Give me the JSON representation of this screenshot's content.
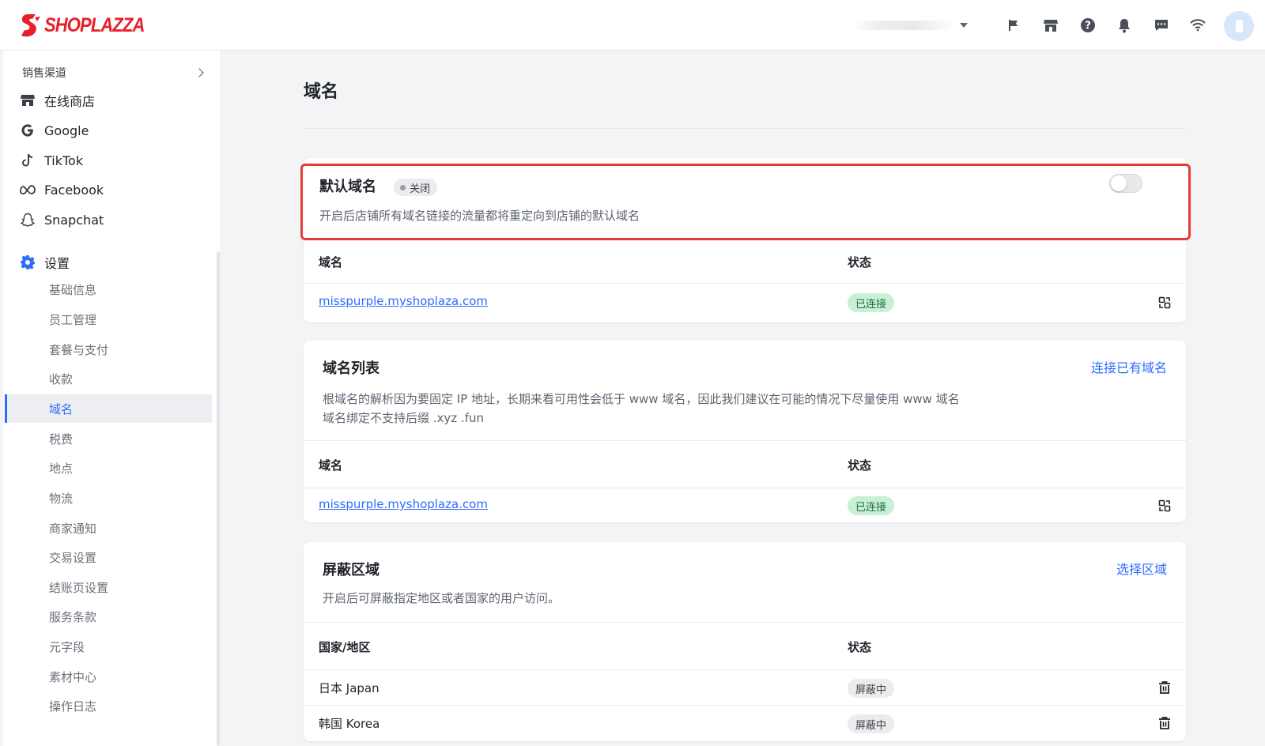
{
  "brand": {
    "logo_text": "SHOPLAZZA",
    "logo_color": "#e6202b"
  },
  "topbar": {
    "icons": [
      "flag-icon",
      "store-icon",
      "help-icon",
      "bell-icon",
      "message-icon",
      "wifi-icon"
    ]
  },
  "sidebar": {
    "section_label": "销售渠道",
    "channels": [
      {
        "label": "在线商店",
        "icon": "store-icon"
      },
      {
        "label": "Google",
        "icon": "google-icon"
      },
      {
        "label": "TikTok",
        "icon": "tiktok-icon"
      },
      {
        "label": "Facebook",
        "icon": "meta-icon"
      },
      {
        "label": "Snapchat",
        "icon": "snapchat-icon"
      }
    ],
    "settings_label": "设置",
    "settings_items": [
      "基础信息",
      "员工管理",
      "套餐与支付",
      "收款",
      "域名",
      "税费",
      "地点",
      "物流",
      "商家通知",
      "交易设置",
      "结账页设置",
      "服务条款",
      "元字段",
      "素材中心",
      "操作日志"
    ],
    "active_item": "域名"
  },
  "main": {
    "page_title": "域名",
    "default_domain": {
      "title": "默认域名",
      "status": "关闭",
      "description": "开启后店铺所有域名链接的流量都将重定向到店铺的默认域名",
      "toggle_on": false,
      "table_headers": {
        "domain": "域名",
        "status": "状态"
      },
      "rows": [
        {
          "domain": "misspurple.myshoplaza.com",
          "status": "已连接"
        }
      ]
    },
    "domain_list": {
      "title": "域名列表",
      "action": "连接已有域名",
      "description_line1": "根域名的解析因为要固定 IP 地址，长期来看可用性会低于 www 域名，因此我们建议在可能的情况下尽量使用 www 域名",
      "description_line2": "域名绑定不支持后缀 .xyz .fun",
      "table_headers": {
        "domain": "域名",
        "status": "状态"
      },
      "rows": [
        {
          "domain": "misspurple.myshoplaza.com",
          "status": "已连接"
        }
      ]
    },
    "block_region": {
      "title": "屏蔽区域",
      "action": "选择区域",
      "description": "开启后可屏蔽指定地区或者国家的用户访问。",
      "table_headers": {
        "country": "国家/地区",
        "status": "状态"
      },
      "rows": [
        {
          "country": "日本 Japan",
          "status": "屏蔽中"
        },
        {
          "country": "韩国 Korea",
          "status": "屏蔽中"
        }
      ]
    }
  },
  "colors": {
    "accent": "#2f6bff",
    "highlight": "#e63a3a",
    "connected_bg": "#c8f0d6"
  }
}
